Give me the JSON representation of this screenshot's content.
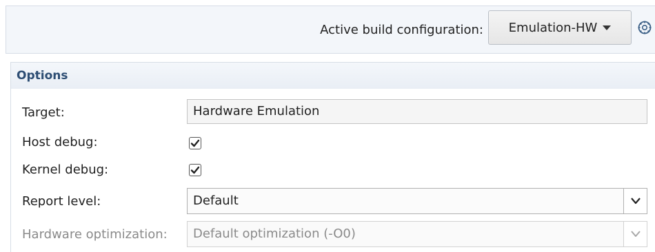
{
  "toolbar": {
    "build_config_label": "Active build configuration:",
    "build_config_value": "Emulation-HW",
    "settings_icon": "gear-globe-icon"
  },
  "options": {
    "title": "Options",
    "target": {
      "label": "Target:",
      "value": "Hardware Emulation"
    },
    "host_debug": {
      "label": "Host debug:",
      "checked": true
    },
    "kernel_debug": {
      "label": "Kernel debug:",
      "checked": true
    },
    "report_level": {
      "label": "Report level:",
      "value": "Default"
    },
    "hardware_optimization": {
      "label": "Hardware optimization:",
      "value": "Default optimization (-O0)",
      "enabled": false
    }
  }
}
